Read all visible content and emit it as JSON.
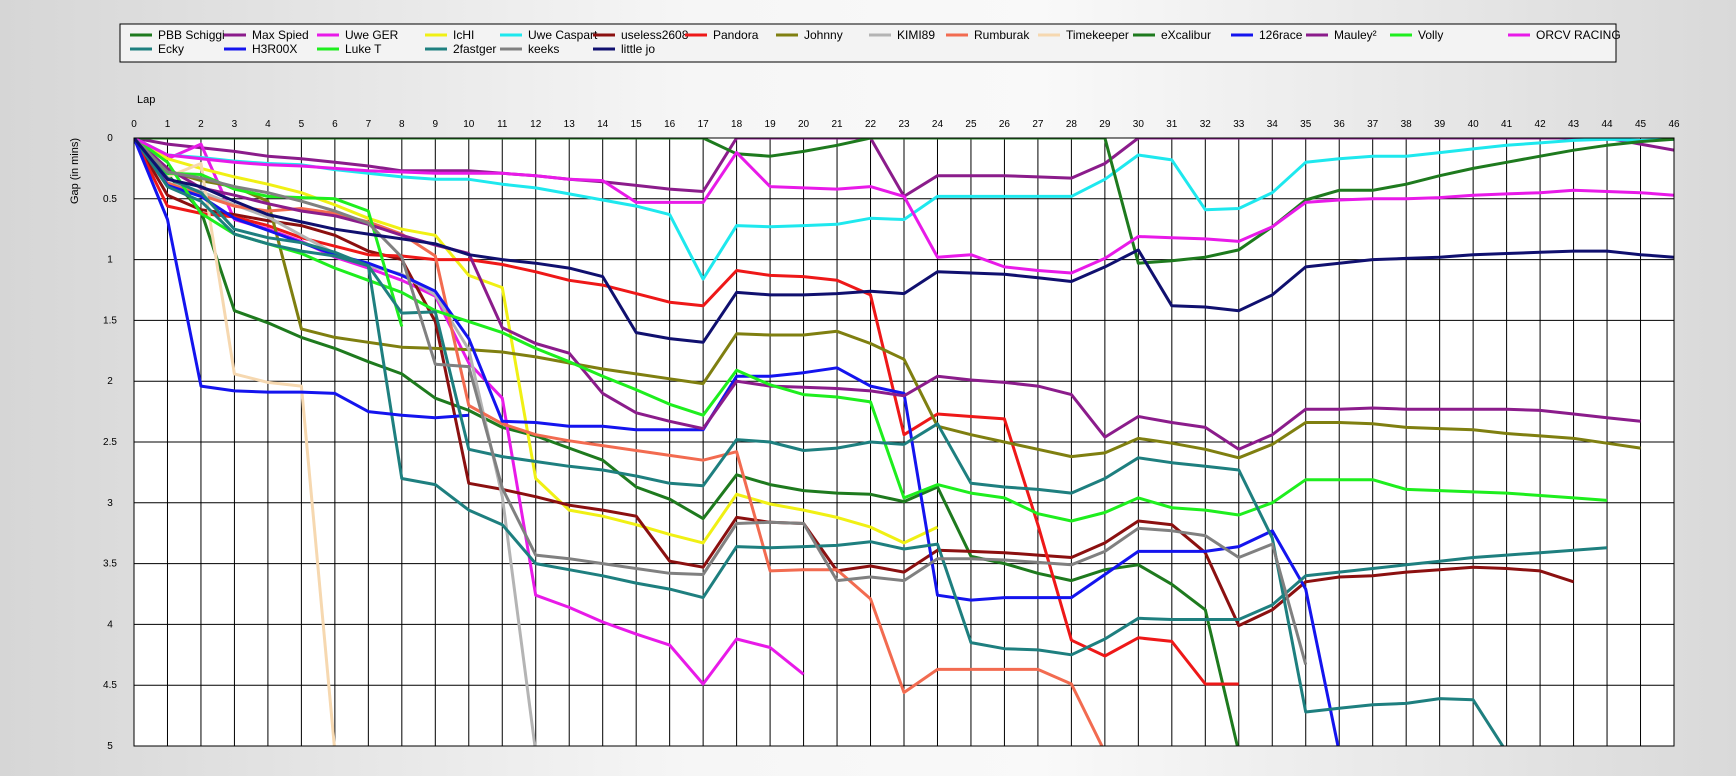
{
  "chart_data": {
    "type": "line",
    "xlabel": "Lap",
    "ylabel": "Gap (in mins)",
    "xlim": [
      0,
      46
    ],
    "ylim": [
      0,
      5
    ],
    "y_inverted": true,
    "grid": true,
    "legend_position": "top",
    "x_ticks": [
      "0",
      "1",
      "2",
      "3",
      "4",
      "5",
      "6",
      "7",
      "8",
      "9",
      "10",
      "11",
      "12",
      "13",
      "14",
      "15",
      "16",
      "17",
      "18",
      "19",
      "20",
      "21",
      "22",
      "23",
      "24",
      "25",
      "26",
      "27",
      "28",
      "29",
      "30",
      "31",
      "32",
      "33",
      "34",
      "35",
      "36",
      "37",
      "38",
      "39",
      "40",
      "41",
      "42",
      "43",
      "44",
      "45",
      "46"
    ],
    "y_ticks": [
      "0",
      "0.5",
      "1",
      "1.5",
      "2",
      "2.5",
      "3",
      "3.5",
      "4",
      "4.5",
      "5"
    ],
    "series": [
      {
        "name": "PBB Schiggi",
        "color": "#1e7a1e",
        "values": [
          0,
          0.3,
          0.6,
          1.42,
          1.52,
          1.64,
          1.73,
          1.84,
          1.94,
          2.14,
          2.24,
          2.38,
          2.45,
          2.55,
          2.65,
          2.87,
          2.97,
          3.13,
          2.77,
          2.85,
          2.9,
          2.92,
          2.93,
          2.99,
          2.87,
          3.44,
          3.5,
          3.58,
          3.64,
          3.55,
          3.51,
          3.67,
          3.88,
          5.05
        ]
      },
      {
        "name": "Max Spied",
        "color": "#8b1c8b",
        "values": [
          0,
          0.05,
          0.08,
          0.11,
          0.15,
          0.17,
          0.2,
          0.23,
          0.27,
          0.27,
          0.27,
          0.29,
          0.31,
          0.34,
          0.36,
          0.39,
          0.42,
          0.44,
          0,
          0,
          0,
          0,
          0,
          0.48,
          0.31,
          0.31,
          0.31,
          0.32,
          0.33,
          0.21,
          0,
          0,
          0,
          0,
          0,
          0,
          0,
          0,
          0,
          0,
          0,
          0,
          0,
          0,
          0,
          0.05,
          0.1
        ]
      },
      {
        "name": "Uwe GER",
        "color": "#e81ae8",
        "values": [
          0,
          0.17,
          0.05,
          0.67,
          0.75,
          0.85,
          0.98,
          1.07,
          1.17,
          1.3,
          1.85,
          2.14,
          3.76,
          3.86,
          3.98,
          4.08,
          4.17,
          4.49,
          4.12,
          4.19,
          4.41
        ]
      },
      {
        "name": "IcHI",
        "color": "#f0f014",
        "values": [
          0,
          0.17,
          0.25,
          0.32,
          0.38,
          0.45,
          0.55,
          0.66,
          0.75,
          0.8,
          1.13,
          1.23,
          2.8,
          3.06,
          3.11,
          3.18,
          3.26,
          3.33,
          2.93,
          3.01,
          3.06,
          3.12,
          3.2,
          3.33,
          3.2
        ]
      },
      {
        "name": "Uwe Caspart",
        "color": "#1ee8ee",
        "values": [
          0,
          0.14,
          0.16,
          0.19,
          0.21,
          0.22,
          0.26,
          0.29,
          0.32,
          0.34,
          0.34,
          0.38,
          0.41,
          0.46,
          0.51,
          0.56,
          0.63,
          1.16,
          0.72,
          0.73,
          0.72,
          0.71,
          0.66,
          0.67,
          0.48,
          0.48,
          0.48,
          0.48,
          0.48,
          0.34,
          0.14,
          0.18,
          0.59,
          0.58,
          0.45,
          0.2,
          0.17,
          0.15,
          0.15,
          0.12,
          0.09,
          0.06,
          0.04,
          0.02,
          0.01,
          0.02,
          0.01
        ]
      },
      {
        "name": "useless2608",
        "color": "#8b1010",
        "values": [
          0,
          0.47,
          0.59,
          0.63,
          0.68,
          0.72,
          0.8,
          0.93,
          1.0,
          1.51,
          2.84,
          2.89,
          2.95,
          3.02,
          3.06,
          3.11,
          3.48,
          3.53,
          3.12,
          3.16,
          3.17,
          3.56,
          3.52,
          3.57,
          3.39,
          3.4,
          3.41,
          3.43,
          3.45,
          3.33,
          3.15,
          3.18,
          3.41,
          4.01,
          3.88,
          3.65,
          3.61,
          3.6,
          3.57,
          3.55,
          3.53,
          3.54,
          3.56,
          3.65
        ]
      },
      {
        "name": "Pandora",
        "color": "#ee1818",
        "values": [
          0,
          0.56,
          0.62,
          0.65,
          0.72,
          0.82,
          0.89,
          0.96,
          0.97,
          1.0,
          1.0,
          1.04,
          1.1,
          1.17,
          1.21,
          1.28,
          1.35,
          1.38,
          1.09,
          1.13,
          1.14,
          1.17,
          1.29,
          2.44,
          2.27,
          2.29,
          2.31,
          3.18,
          4.13,
          4.26,
          4.11,
          4.14,
          4.49,
          4.49
        ]
      },
      {
        "name": "Johnny",
        "color": "#7f7f10",
        "values": [
          0,
          0.27,
          0.35,
          0.4,
          0.52,
          1.57,
          1.64,
          1.68,
          1.72,
          1.73,
          1.74,
          1.76,
          1.8,
          1.85,
          1.9,
          1.94,
          1.98,
          2.02,
          1.61,
          1.62,
          1.62,
          1.59,
          1.69,
          1.82,
          2.37,
          2.44,
          2.5,
          2.56,
          2.62,
          2.59,
          2.47,
          2.51,
          2.56,
          2.63,
          2.52,
          2.34,
          2.34,
          2.35,
          2.38,
          2.39,
          2.4,
          2.43,
          2.45,
          2.47,
          2.51,
          2.55
        ]
      },
      {
        "name": "KIMI89",
        "color": "#b4b4b4",
        "values": [
          0,
          0.37,
          0.44,
          0.55,
          0.65,
          0.8,
          0.95,
          1.05,
          1.12,
          1.29,
          1.74,
          2.95,
          5.05
        ]
      },
      {
        "name": "Rumburak",
        "color": "#f26b50",
        "values": [
          0,
          0.37,
          0.47,
          0.56,
          0.6,
          0.58,
          0.62,
          0.69,
          0.79,
          0.97,
          2.2,
          2.35,
          2.44,
          2.49,
          2.53,
          2.57,
          2.61,
          2.65,
          2.58,
          3.56,
          3.55,
          3.55,
          3.79,
          4.56,
          4.37,
          4.37,
          4.37,
          4.37,
          4.49,
          5.05
        ]
      },
      {
        "name": "Timekeeper",
        "color": "#f6d8b0",
        "values": [
          0,
          0.32,
          0.21,
          1.94,
          2.01,
          2.04,
          5.05
        ]
      },
      {
        "name": "eXcalibur",
        "color": "#1e7a1e",
        "values": [
          0,
          0,
          0,
          0,
          0,
          0,
          0,
          0,
          0,
          0,
          0,
          0,
          0,
          0,
          0,
          0,
          0,
          0,
          0.13,
          0.15,
          0.11,
          0.06,
          0,
          0,
          0,
          0,
          0,
          0,
          0,
          0,
          1.03,
          1.01,
          0.98,
          0.92,
          0.73,
          0.51,
          0.43,
          0.43,
          0.38,
          0.31,
          0.25,
          0.2,
          0.15,
          0.1,
          0.06,
          0.03,
          0.01
        ]
      },
      {
        "name": "126race",
        "color": "#1414ee",
        "values": [
          0,
          0.39,
          0.48,
          0.66,
          0.76,
          0.86,
          0.96,
          1.03,
          1.13,
          1.26,
          1.65,
          2.33,
          2.34,
          2.37,
          2.37,
          2.4,
          2.4,
          2.4,
          1.96,
          1.96,
          1.93,
          1.89,
          2.04,
          2.1,
          3.76,
          3.8,
          3.78,
          3.78,
          3.78,
          3.59,
          3.4,
          3.4,
          3.4,
          3.36,
          3.23,
          3.71,
          5.05
        ]
      },
      {
        "name": "Mauley²",
        "color": "#8b1c8b",
        "values": [
          0,
          0.25,
          0.41,
          0.47,
          0.54,
          0.6,
          0.64,
          0.71,
          0.8,
          0.88,
          0.95,
          1.56,
          1.69,
          1.77,
          2.1,
          2.26,
          2.33,
          2.39,
          2.0,
          2.04,
          2.05,
          2.06,
          2.08,
          2.12,
          1.96,
          1.99,
          2.01,
          2.04,
          2.11,
          2.46,
          2.29,
          2.34,
          2.38,
          2.56,
          2.44,
          2.23,
          2.23,
          2.22,
          2.23,
          2.23,
          2.23,
          2.23,
          2.24,
          2.27,
          2.3,
          2.33
        ]
      },
      {
        "name": "Volly",
        "color": "#1eee1e",
        "values": [
          0,
          0.2,
          0.62,
          0.79,
          0.87,
          0.95,
          1.07,
          1.17,
          1.27,
          1.42,
          1.51,
          1.6,
          1.73,
          1.84,
          1.96,
          2.07,
          2.19,
          2.28,
          1.91,
          2.03,
          2.11,
          2.13,
          2.17,
          2.96,
          2.85,
          2.92,
          2.96,
          3.09,
          3.15,
          3.08,
          2.96,
          3.04,
          3.06,
          3.1,
          3.0,
          2.81,
          2.81,
          2.81,
          2.89,
          2.9,
          2.91,
          2.92,
          2.94,
          2.96,
          2.98
        ]
      },
      {
        "name": "ORCV RACING",
        "color": "#e81ae8",
        "values": [
          0,
          0.14,
          0.17,
          0.2,
          0.22,
          0.23,
          0.25,
          0.27,
          0.28,
          0.29,
          0.29,
          0.29,
          0.31,
          0.34,
          0.35,
          0.53,
          0.53,
          0.53,
          0.12,
          0.4,
          0.41,
          0.42,
          0.4,
          0.48,
          0.98,
          0.96,
          1.06,
          1.09,
          1.11,
          0.99,
          0.81,
          0.82,
          0.83,
          0.85,
          0.73,
          0.53,
          0.51,
          0.5,
          0.5,
          0.49,
          0.47,
          0.46,
          0.45,
          0.43,
          0.44,
          0.45,
          0.47
        ]
      },
      {
        "name": "Ecky",
        "color": "#1e7f7f",
        "values": [
          0,
          0.4,
          0.52,
          0.79,
          0.87,
          0.93,
          0.97,
          1.05,
          2.8,
          2.85,
          3.06,
          3.18,
          3.5,
          3.55,
          3.6,
          3.66,
          3.71,
          3.78,
          3.36,
          3.37,
          3.36,
          3.35,
          3.32,
          3.38,
          3.34,
          4.15,
          4.2,
          4.21,
          4.25,
          4.12,
          3.95,
          3.96,
          3.96,
          3.96,
          3.84,
          3.6,
          3.57,
          3.54,
          3.51,
          3.48,
          3.45,
          3.43,
          3.41,
          3.39,
          3.37
        ]
      },
      {
        "name": "H3R00X",
        "color": "#1414ee",
        "values": [
          0,
          0.67,
          2.04,
          2.08,
          2.09,
          2.09,
          2.1,
          2.25,
          2.28,
          2.3,
          2.28
        ]
      },
      {
        "name": "Luke T",
        "color": "#1eee1e",
        "values": [
          0,
          0.29,
          0.3,
          0.42,
          0.48,
          0.49,
          0.5,
          0.6,
          1.55
        ]
      },
      {
        "name": "2fastger",
        "color": "#1e7f7f",
        "values": [
          0,
          0.33,
          0.45,
          0.75,
          0.82,
          0.86,
          0.94,
          1.05,
          1.44,
          1.43,
          2.56,
          2.62,
          2.66,
          2.7,
          2.73,
          2.78,
          2.84,
          2.86,
          2.48,
          2.5,
          2.57,
          2.55,
          2.5,
          2.52,
          2.35,
          2.84,
          2.87,
          2.89,
          2.92,
          2.8,
          2.63,
          2.67,
          2.7,
          2.73,
          3.29,
          4.72,
          4.69,
          4.66,
          4.65,
          4.61,
          4.62,
          5.05
        ]
      },
      {
        "name": "keeks",
        "color": "#808080",
        "values": [
          0,
          0.28,
          0.33,
          0.4,
          0.45,
          0.52,
          0.6,
          0.7,
          0.98,
          1.86,
          1.88,
          2.88,
          3.43,
          3.46,
          3.5,
          3.54,
          3.58,
          3.59,
          3.17,
          3.16,
          3.17,
          3.64,
          3.61,
          3.64,
          3.46,
          3.46,
          3.47,
          3.49,
          3.51,
          3.4,
          3.21,
          3.23,
          3.27,
          3.45,
          3.34,
          4.33
        ]
      },
      {
        "name": "little jo",
        "color": "#10106f",
        "values": [
          0,
          0.34,
          0.4,
          0.52,
          0.63,
          0.69,
          0.75,
          0.79,
          0.83,
          0.87,
          0.96,
          1.0,
          1.03,
          1.07,
          1.14,
          1.6,
          1.65,
          1.68,
          1.27,
          1.29,
          1.29,
          1.28,
          1.26,
          1.28,
          1.1,
          1.11,
          1.12,
          1.15,
          1.18,
          1.06,
          0.92,
          1.38,
          1.39,
          1.42,
          1.29,
          1.06,
          1.03,
          1.0,
          0.99,
          0.98,
          0.96,
          0.95,
          0.94,
          0.93,
          0.93,
          0.96,
          0.98
        ]
      }
    ]
  }
}
